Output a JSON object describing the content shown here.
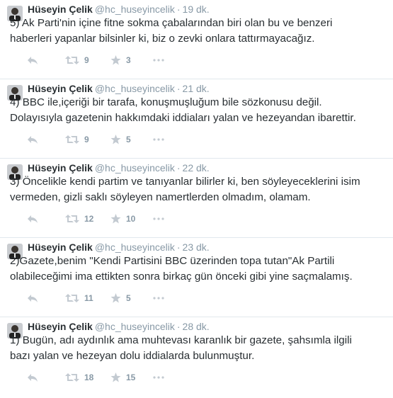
{
  "tweets": [
    {
      "fullname": "Hüseyin Çelik",
      "username": "@hc_huseyincelik",
      "time": "19 dk.",
      "text": "5) Ak Parti'nin içine fitne sokma çabalarından biri olan bu ve benzeri\nhaberleri yapanlar bilsinler ki, biz o zevki onlara tattırmayacağız.",
      "retweets": "9",
      "favorites": "3"
    },
    {
      "fullname": "Hüseyin Çelik",
      "username": "@hc_huseyincelik",
      "time": "21 dk.",
      "text": "4) BBC ile,içeriği bir tarafa, konuşmuşluğum bile sözkonusu değil.\nDolayısıyla gazetenin hakkımdaki iddiaları yalan ve hezeyandan ibarettir.",
      "retweets": "9",
      "favorites": "5"
    },
    {
      "fullname": "Hüseyin Çelik",
      "username": "@hc_huseyincelik",
      "time": "22 dk.",
      "text": "3) Öncelikle kendi partim ve tanıyanlar bilirler ki, ben söyleyeceklerini isim\nvermeden, gizli saklı söyleyen namertlerden olmadım, olamam.",
      "retweets": "12",
      "favorites": "10"
    },
    {
      "fullname": "Hüseyin Çelik",
      "username": "@hc_huseyincelik",
      "time": "23 dk.",
      "text": "2)Gazete,benim \"Kendi Partisini BBC üzerinden topa tutan\"Ak Partili\nolabileceğimi ima ettikten sonra birkaç gün önceki gibi yine saçmalamış.",
      "retweets": "11",
      "favorites": "5"
    },
    {
      "fullname": "Hüseyin Çelik",
      "username": "@hc_huseyincelik",
      "time": "28 dk.",
      "text": "1) Bugün, adı aydınlık ama muhtevası karanlık bir gazete, şahsımla ilgili\nbazı yalan ve hezeyan dolu iddialarda bulunmuştur.",
      "retweets": "18",
      "favorites": "15"
    }
  ],
  "icons": {
    "reply": "reply-icon",
    "retweet": "retweet-icon",
    "favorite": "star-icon",
    "more": "more-icon"
  },
  "colors": {
    "text": "#292f33",
    "muted": "#8899a6",
    "icon": "#9aa4ad",
    "divider": "#e1e8ed"
  }
}
